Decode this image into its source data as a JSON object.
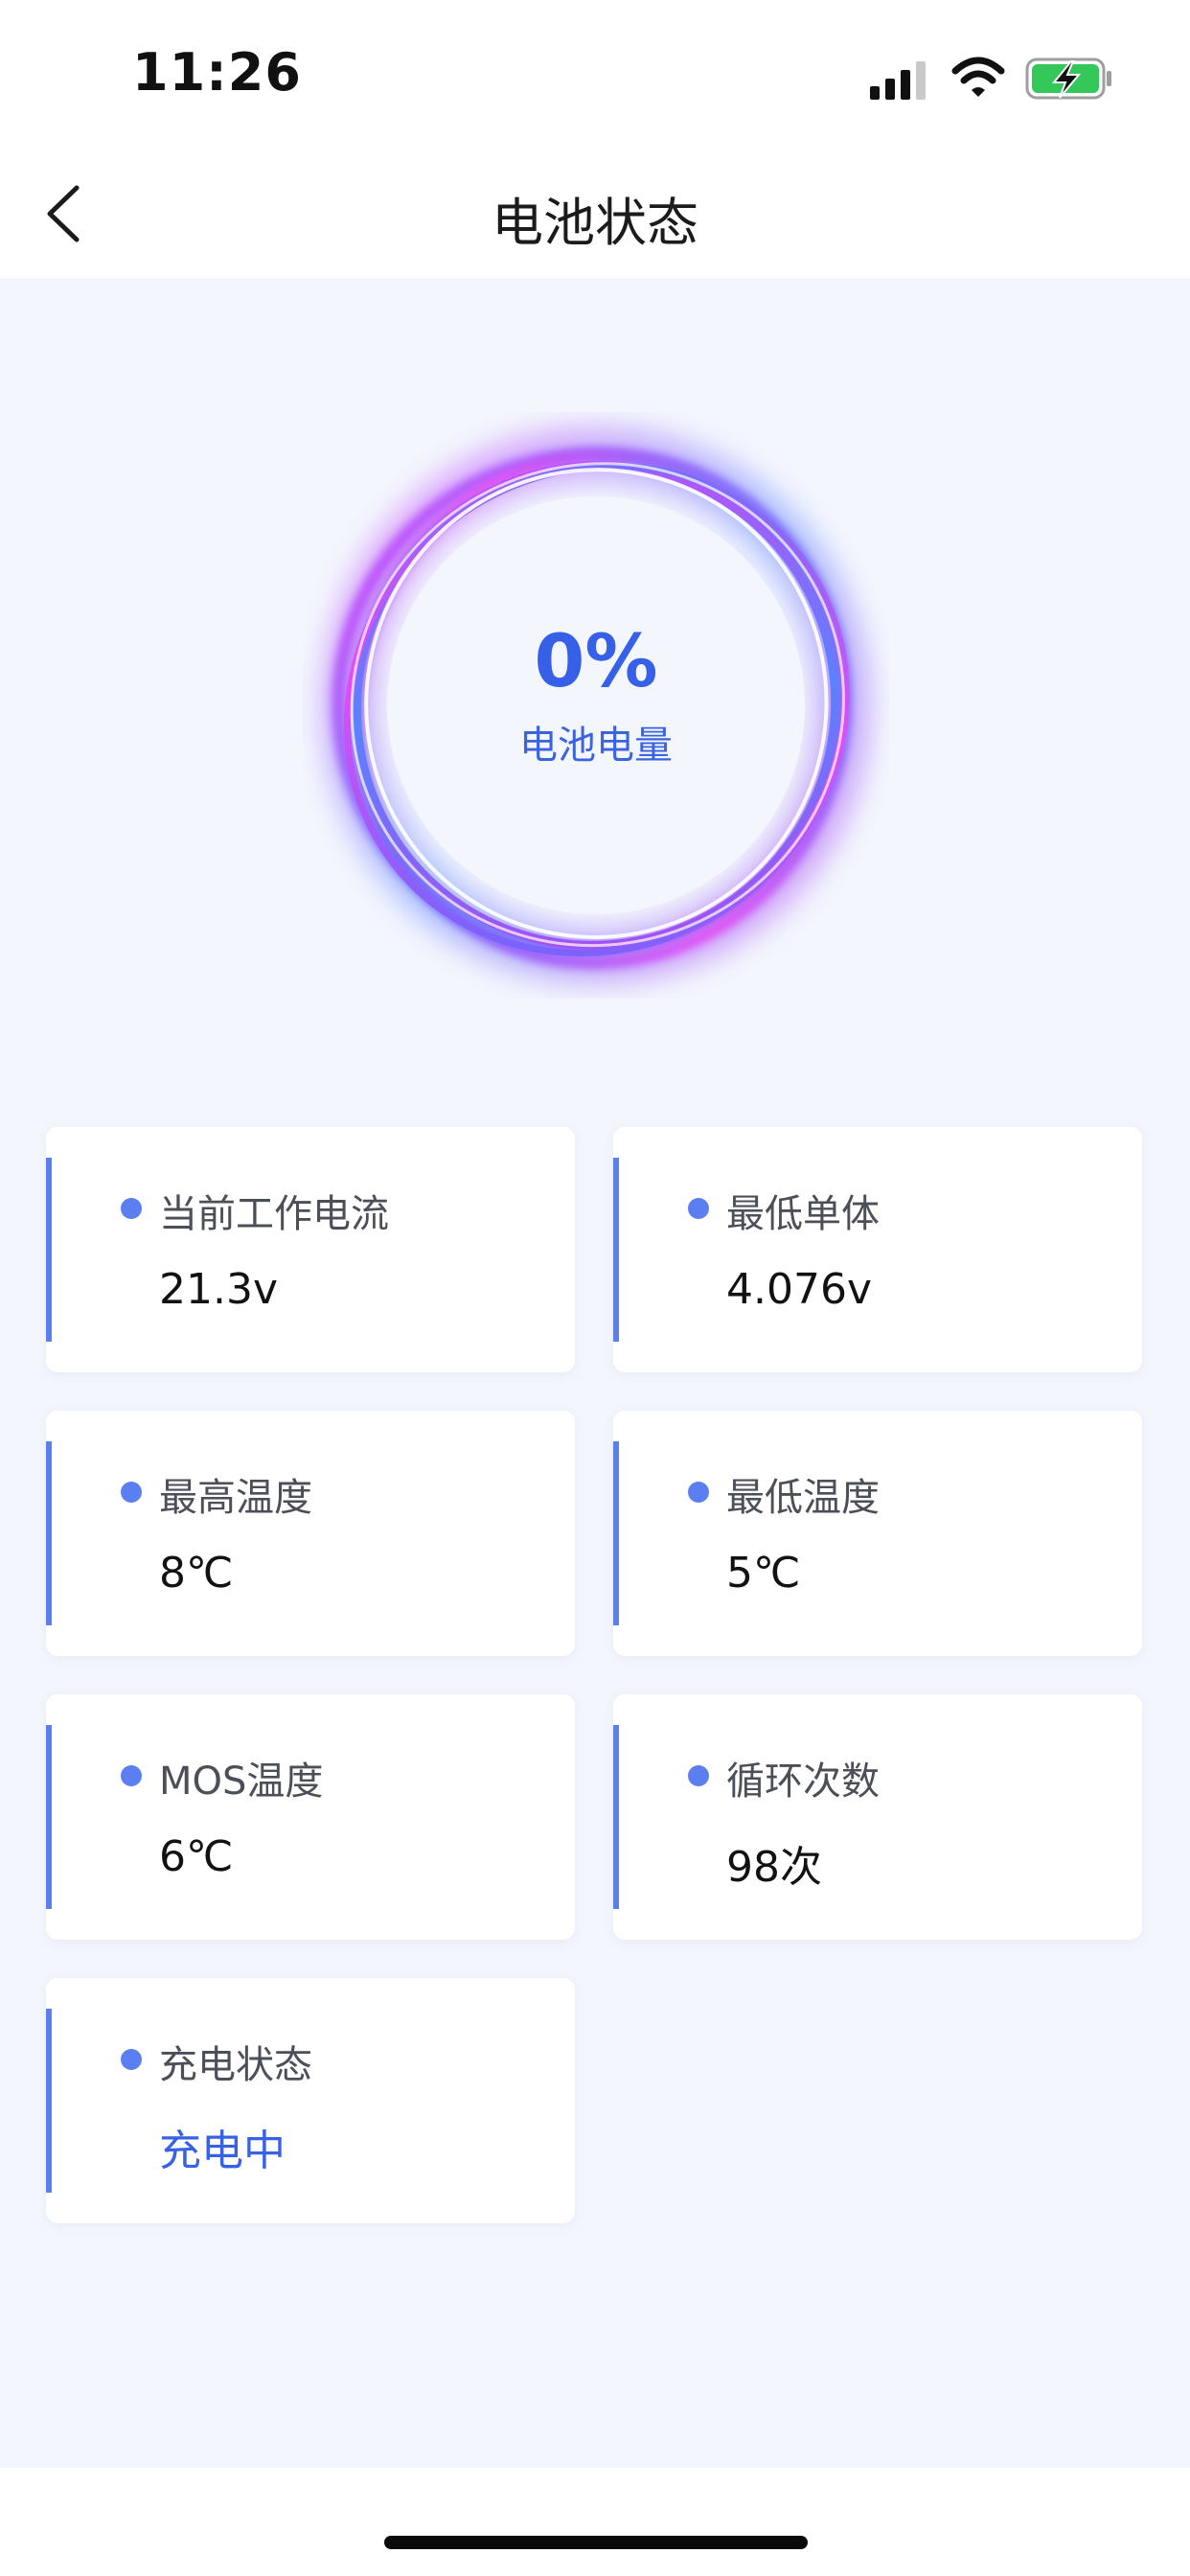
{
  "status_bar": {
    "time": "11:26",
    "icons": [
      "signal-icon",
      "wifi-icon",
      "battery-charging-icon"
    ]
  },
  "nav": {
    "title": "电池状态",
    "back_icon": "chevron-left-icon"
  },
  "battery_ring": {
    "value": "0%",
    "label": "电池电量",
    "colors": {
      "accent": "#3760e8",
      "ring_pink": "#e23cf5",
      "ring_blue": "#4f7bff"
    }
  },
  "cards": [
    {
      "label": "当前工作电流",
      "value": "21.3v"
    },
    {
      "label": "最低单体",
      "value": "4.076v"
    },
    {
      "label": "最高温度",
      "value": "8℃"
    },
    {
      "label": "最低温度",
      "value": "5℃"
    },
    {
      "label": "MOS温度",
      "value": "6℃"
    },
    {
      "label": "循环次数",
      "value": "98次"
    },
    {
      "label": "充电状态",
      "value": "充电中"
    }
  ],
  "colors": {
    "background": "#f3f6fd",
    "card_accent": "#5b7ef0",
    "status_value_highlight": "#3762e6"
  }
}
